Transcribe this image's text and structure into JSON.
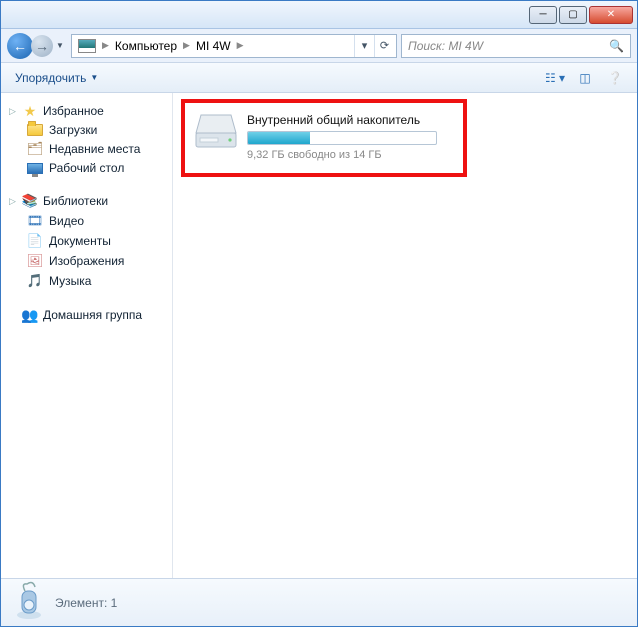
{
  "breadcrumbs": {
    "root": "Компьютер",
    "current": "MI 4W"
  },
  "search": {
    "placeholder": "Поиск: MI 4W"
  },
  "toolbar": {
    "organize": "Упорядочить"
  },
  "sidebar": {
    "favorites": {
      "label": "Избранное",
      "items": {
        "downloads": "Загрузки",
        "recent": "Недавние места",
        "desktop": "Рабочий стол"
      }
    },
    "libraries": {
      "label": "Библиотеки",
      "items": {
        "video": "Видео",
        "documents": "Документы",
        "pictures": "Изображения",
        "music": "Музыка"
      }
    },
    "homegroup": {
      "label": "Домашняя группа"
    }
  },
  "drive": {
    "name": "Внутренний общий накопитель",
    "free_text": "9,32 ГБ свободно из 14 ГБ",
    "used_percent": 33
  },
  "status": {
    "text": "Элемент: 1"
  }
}
